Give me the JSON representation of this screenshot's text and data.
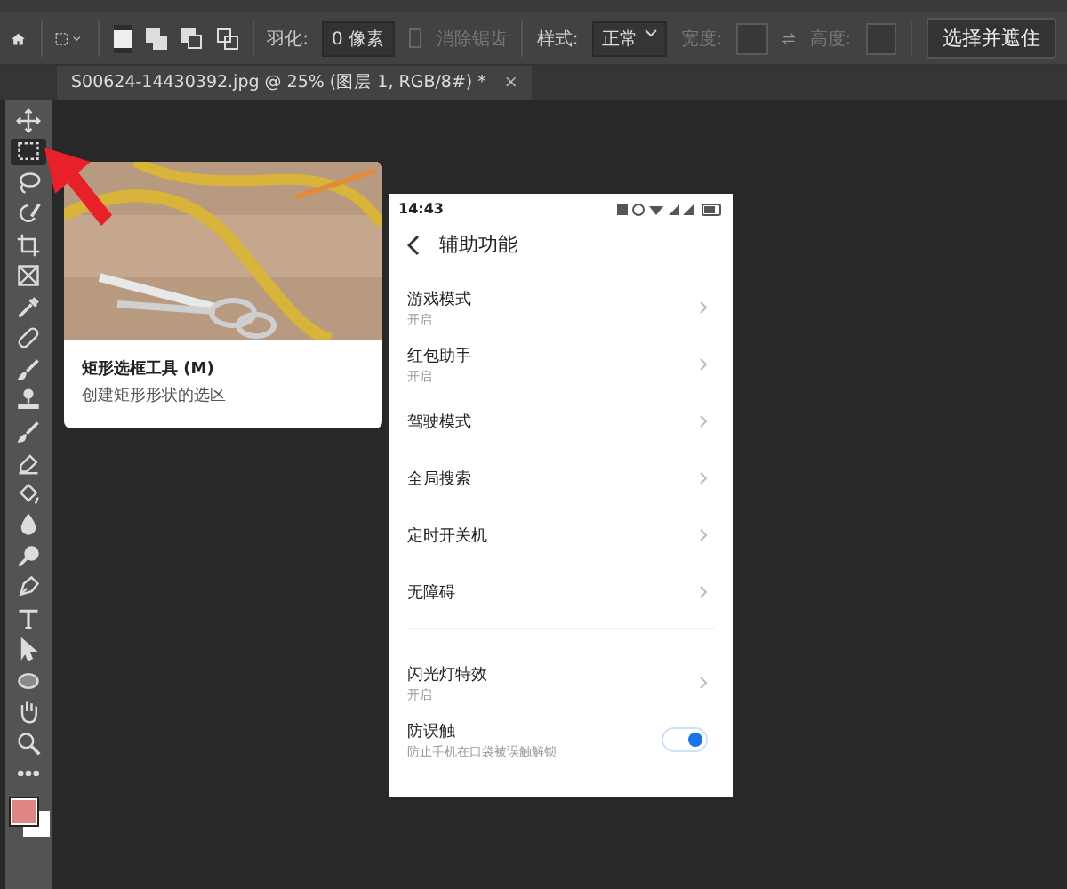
{
  "options_bar": {
    "feather_label": "羽化:",
    "feather_value": "0 像素",
    "antialias": {
      "label": "消除锯齿",
      "checked": false,
      "disabled": true
    },
    "style_label": "样式:",
    "style_value": "正常",
    "width_label": "宽度:",
    "height_label": "高度:",
    "select_mask_button": "选择并遮住"
  },
  "document_tab": {
    "title": "S00624-14430392.jpg @ 25% (图层 1, RGB/8#) *",
    "close": "×"
  },
  "tools": [
    {
      "kind": "move",
      "selected": false
    },
    {
      "kind": "marquee",
      "selected": true
    },
    {
      "kind": "lasso",
      "selected": false
    },
    {
      "kind": "quick-select",
      "selected": false
    },
    {
      "kind": "crop",
      "selected": false
    },
    {
      "kind": "frame",
      "selected": false
    },
    {
      "kind": "eyedropper",
      "selected": false
    },
    {
      "kind": "bandage",
      "selected": false
    },
    {
      "kind": "brush",
      "selected": false
    },
    {
      "kind": "stamp",
      "selected": false
    },
    {
      "kind": "brush",
      "selected": false
    },
    {
      "kind": "eraser",
      "selected": false
    },
    {
      "kind": "bucket",
      "selected": false
    },
    {
      "kind": "drop",
      "selected": false
    },
    {
      "kind": "dodge",
      "selected": false
    },
    {
      "kind": "pen",
      "selected": false
    },
    {
      "kind": "type",
      "selected": false
    },
    {
      "kind": "pointer",
      "selected": false
    },
    {
      "kind": "ellipse",
      "selected": false
    },
    {
      "kind": "hand",
      "selected": false
    },
    {
      "kind": "zoom",
      "selected": false
    },
    {
      "kind": "more",
      "selected": false
    }
  ],
  "tooltip": {
    "title": "矩形选框工具 (M)",
    "description": "创建矩形形状的选区"
  },
  "phone": {
    "time": "14:43",
    "title": "辅助功能",
    "sections": [
      [
        {
          "name": "游戏模式",
          "sub": "开启",
          "kind": "chevron"
        },
        {
          "name": "红包助手",
          "sub": "开启",
          "kind": "chevron"
        },
        {
          "name": "驾驶模式",
          "kind": "chevron"
        },
        {
          "name": "全局搜索",
          "kind": "chevron"
        },
        {
          "name": "定时开关机",
          "kind": "chevron"
        },
        {
          "name": "无障碍",
          "kind": "chevron"
        }
      ],
      [
        {
          "name": "闪光灯特效",
          "sub": "开启",
          "kind": "chevron"
        },
        {
          "name": "防误触",
          "sub": "防止手机在口袋被误触解锁",
          "kind": "toggle",
          "on": true
        }
      ]
    ]
  }
}
